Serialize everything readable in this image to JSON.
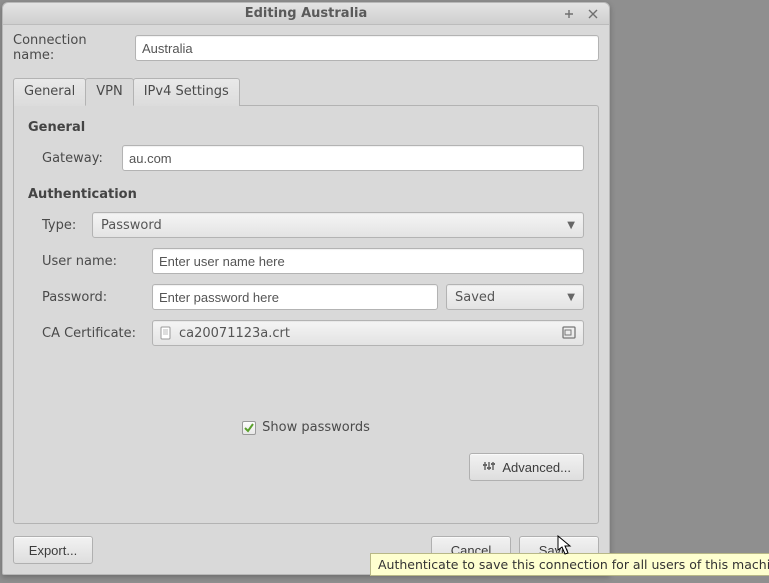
{
  "window": {
    "title": "Editing Australia"
  },
  "connection": {
    "label": "Connection name:",
    "value": "Australia"
  },
  "tabs": {
    "general": "General",
    "vpn": "VPN",
    "ipv4": "IPv4 Settings"
  },
  "sections": {
    "general": "General",
    "auth": "Authentication"
  },
  "gateway": {
    "label": "Gateway:",
    "value": "au.com"
  },
  "auth": {
    "type_label": "Type:",
    "type_value": "Password",
    "user_label": "User name:",
    "user_placeholder": "Enter user name here",
    "password_label": "Password:",
    "password_placeholder": "Enter password here",
    "saved": "Saved",
    "ca_label": "CA Certificate:",
    "ca_file": "ca20071123a.crt",
    "show_passwords": "Show passwords"
  },
  "buttons": {
    "advanced": "Advanced...",
    "export": "Export...",
    "cancel": "Cancel",
    "save": "Save..."
  },
  "tooltip": "Authenticate to save this connection for all users of this machine."
}
